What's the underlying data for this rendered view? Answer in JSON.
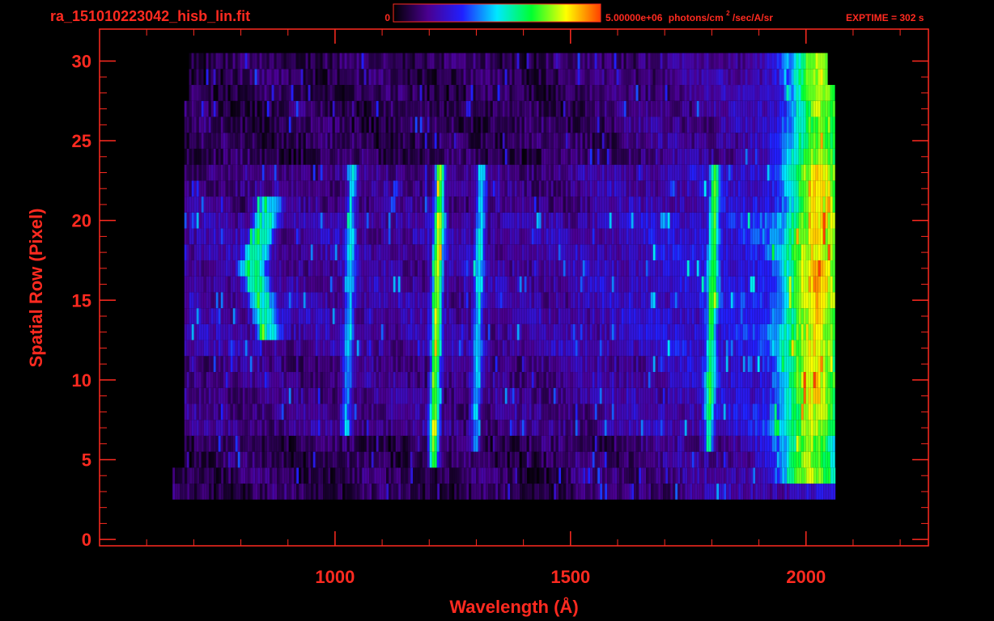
{
  "chart_data": {
    "type": "heatmap",
    "title": "ra_151010223042_hisb_lin.fit",
    "xlabel": "Wavelength (Å)",
    "ylabel": "Spatial Row (Pixel)",
    "xlim": [
      500,
      2260
    ],
    "ylim": [
      -0.4,
      32
    ],
    "x_ticks": [
      1000,
      1500,
      2000
    ],
    "y_ticks": [
      0,
      5,
      10,
      15,
      20,
      25,
      30
    ],
    "grid": false,
    "color_scale": {
      "min_label": "0",
      "max_label": "5.00000e+06",
      "unit_prefix": "photons/cm",
      "unit_superscript": "2",
      "unit_suffix": "/sec/A/sr",
      "stops": [
        "#000000",
        "#4a0090",
        "#2020ff",
        "#00e8ff",
        "#00ff30",
        "#ffff00",
        "#ff4000"
      ]
    },
    "exposure_label": "EXPTIME = 302 s",
    "coverage": {
      "x_start": 680,
      "x_end": 2060,
      "row_start": 3,
      "row_end": 30
    },
    "features": [
      {
        "wavelength": 810,
        "rows": [
          13,
          21
        ],
        "level": 0.34
      },
      {
        "wavelength": 835,
        "rows": [
          13,
          21
        ],
        "level": 0.3
      },
      {
        "wavelength": 1030,
        "rows": [
          7,
          23
        ],
        "level": 0.3
      },
      {
        "wavelength": 1216,
        "rows": [
          5,
          23
        ],
        "level": 0.62
      },
      {
        "wavelength": 1304,
        "rows": [
          6,
          23
        ],
        "level": 0.32
      },
      {
        "wavelength": 1800,
        "rows": [
          6,
          23
        ],
        "level": 0.4
      },
      {
        "wavelength": 2020,
        "rows": [
          4,
          30
        ],
        "level": 0.52
      }
    ],
    "colors": {
      "text": "#ff2a20",
      "axis": "#ff2a20",
      "background": "#000000"
    }
  }
}
